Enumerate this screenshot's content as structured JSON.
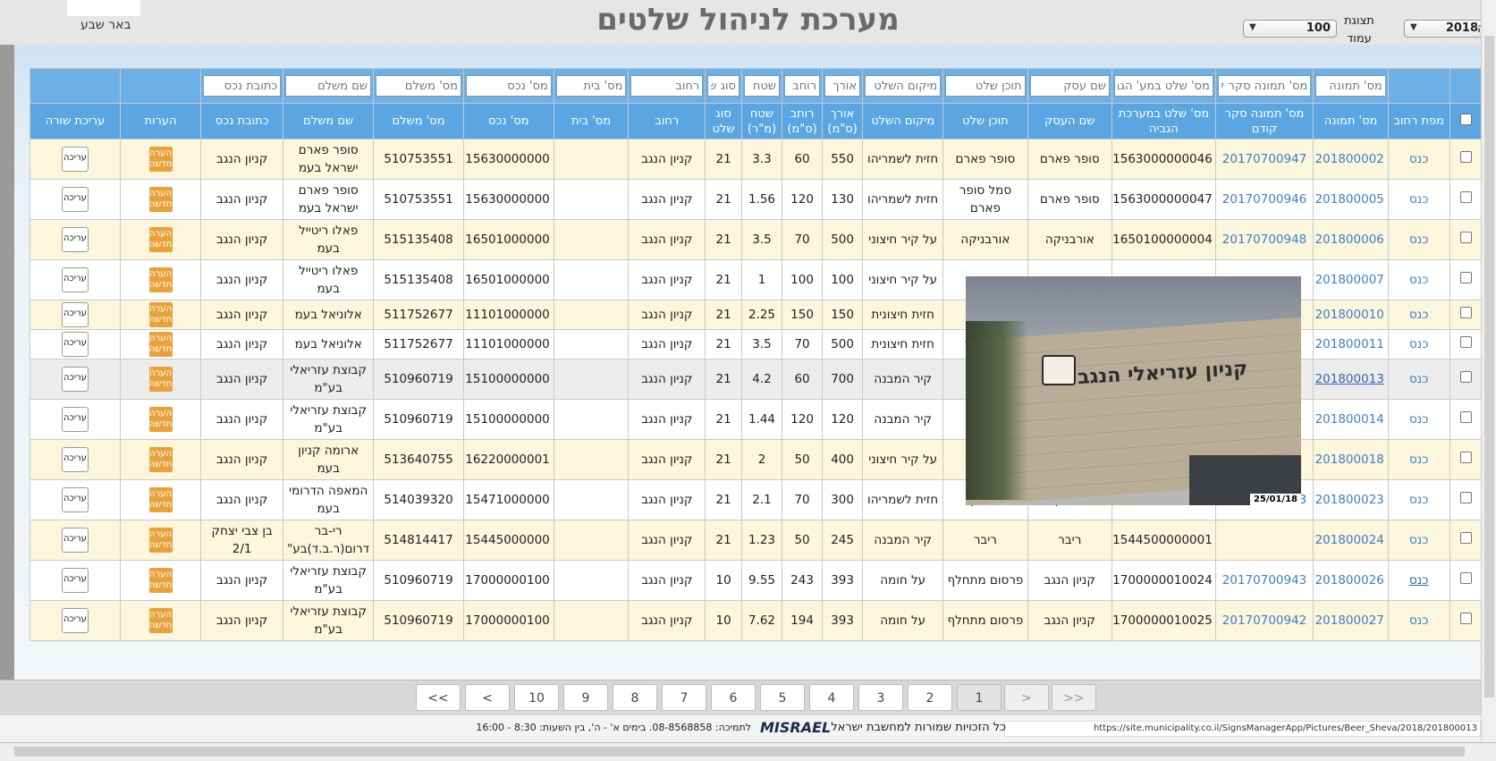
{
  "header": {
    "title": "מערכת לניהול שלטים",
    "city": "באר שבע",
    "year_label": "נה",
    "year_value": "2018",
    "page_size_label": "תצוגת עמוד",
    "page_size_value": "100"
  },
  "filters": [
    "מס' תמונה",
    "מס' תמונה סקר ק",
    "מס' שלט במע' הגב",
    "שם עסק",
    "תוכן שלט",
    "מיקום השלט",
    "אורך",
    "רוחב",
    "שטח",
    "סוג שי",
    "רחוב",
    "מס' בית",
    "מס' נכס",
    "מס' משלם",
    "שם משלם",
    "כתובת נכס"
  ],
  "columns": [
    "",
    "מפת רחוב",
    "מס' תמונה",
    "מס' תמונה סקר קודם",
    "מס' שלט במערכת הגביה",
    "שם העסק",
    "תוכן שלט",
    "מיקום השלט",
    "אורך (ס\"מ)",
    "רוחב (ס\"מ)",
    "שטח (מ\"ר)",
    "סוג שלט",
    "רחוב",
    "מס' בית",
    "מס' נכס",
    "מס' משלם",
    "שם משלם",
    "כתובת נכס",
    "הערות",
    "עריכת שורה"
  ],
  "rows": [
    {
      "map": "כנס",
      "pic": "201800002",
      "prev": "20170700947",
      "sign": "971563000000046",
      "biz": "סופר פארם",
      "content": "סופר פארם",
      "loc": "חזית לשמריהו",
      "len": "550",
      "wid": "60",
      "area": "3.3",
      "type": "21",
      "street": "קניון הנגב",
      "house": "",
      "asset": "9715630000000",
      "payer_no": "510753551",
      "payer": "סופר פארם ישראל בעמ",
      "addr": "קניון הנגב"
    },
    {
      "map": "כנס",
      "pic": "201800005",
      "prev": "20170700946",
      "sign": "971563000000047",
      "biz": "סופר פארם",
      "content": "סמל סופר פארם",
      "loc": "חזית לשמריהו",
      "len": "130",
      "wid": "120",
      "area": "1.56",
      "type": "21",
      "street": "קניון הנגב",
      "house": "",
      "asset": "9715630000000",
      "payer_no": "510753551",
      "payer": "סופר פארם ישראל בעמ",
      "addr": "קניון הנגב"
    },
    {
      "map": "כנס",
      "pic": "201800006",
      "prev": "20170700948",
      "sign": "971650100000004",
      "biz": "אורבניקה",
      "content": "אורבניקה",
      "loc": "על קיר חיצוני",
      "len": "500",
      "wid": "70",
      "area": "3.5",
      "type": "21",
      "street": "קניון הנגב",
      "house": "",
      "asset": "9716501000000",
      "payer_no": "515135408",
      "payer": "פאלו ריטייל בעמ",
      "addr": "קניון הנגב"
    },
    {
      "map": "כנס",
      "pic": "201800007",
      "prev": "",
      "sign": "",
      "biz": "",
      "content": "בניקה",
      "loc": "על קיר חיצוני",
      "len": "100",
      "wid": "100",
      "area": "1",
      "type": "21",
      "street": "קניון הנגב",
      "house": "",
      "asset": "9716501000000",
      "payer_no": "515135408",
      "payer": "פאלו ריטייל בעמ",
      "addr": "קניון הנגב"
    },
    {
      "map": "כנס",
      "pic": "201800010",
      "prev": "",
      "sign": "",
      "biz": "",
      "content": "ונלדס",
      "loc": "חזית חיצונית",
      "len": "150",
      "wid": "150",
      "area": "2.25",
      "type": "21",
      "street": "קניון הנגב",
      "house": "",
      "asset": "9711101000000",
      "payer_no": "511752677",
      "payer": "אלוניאל בעמ",
      "addr": "קניון הנגב"
    },
    {
      "map": "כנס",
      "pic": "201800011",
      "prev": "",
      "sign": "",
      "biz": "",
      "content": "ס הכשר",
      "loc": "חזית חיצונית",
      "len": "500",
      "wid": "70",
      "area": "3.5",
      "type": "21",
      "street": "קניון הנגב",
      "house": "",
      "asset": "9711101000000",
      "payer_no": "511752677",
      "payer": "אלוניאל בעמ",
      "addr": "קניון הנגב"
    },
    {
      "map": "כנס",
      "pic": "201800013",
      "prev": "",
      "sign": "",
      "biz": "",
      "content": "אלי",
      "loc": "קיר המבנה",
      "len": "700",
      "wid": "60",
      "area": "4.2",
      "type": "21",
      "street": "קניון הנגב",
      "house": "",
      "asset": "9715100000000",
      "payer_no": "510960719",
      "payer": "קבוצת עזריאלי בע\"מ",
      "addr": "קניון הנגב"
    },
    {
      "map": "כנס",
      "pic": "201800014",
      "prev": "",
      "sign": "",
      "biz": "",
      "content": "",
      "loc": "קיר המבנה",
      "len": "120",
      "wid": "120",
      "area": "1.44",
      "type": "21",
      "street": "קניון הנגב",
      "house": "",
      "asset": "9715100000000",
      "payer_no": "510960719",
      "payer": "קבוצת עזריאלי בע\"מ",
      "addr": "קניון הנגב"
    },
    {
      "map": "כנס",
      "pic": "201800018",
      "prev": "",
      "sign": "",
      "biz": "",
      "content": "ספרסו",
      "loc": "על קיר חיצוני",
      "len": "400",
      "wid": "50",
      "area": "2",
      "type": "21",
      "street": "קניון הנגב",
      "house": "",
      "asset": "9716220000001",
      "payer_no": "513640755",
      "payer": "ארומה קניון בעמ",
      "addr": "קניון הנגב"
    },
    {
      "map": "כנס",
      "pic": "201800023",
      "prev": "20170701143",
      "sign": "971547100000001",
      "biz": "רולדין",
      "content": "רולדין",
      "loc": "חזית לשמריהו",
      "len": "300",
      "wid": "70",
      "area": "2.1",
      "type": "21",
      "street": "קניון הנגב",
      "house": "",
      "asset": "9715471000000",
      "payer_no": "514039320",
      "payer": "המאפה הדרומי בעמ",
      "addr": "קניון הנגב"
    },
    {
      "map": "כנס",
      "pic": "201800024",
      "prev": "",
      "sign": "971544500000001",
      "biz": "ריבר",
      "content": "ריבר",
      "loc": "קיר המבנה",
      "len": "245",
      "wid": "50",
      "area": "1.23",
      "type": "21",
      "street": "קניון הנגב",
      "house": "",
      "asset": "9715445000000",
      "payer_no": "514814417",
      "payer": "רי-בר דרום(ר.ב.ד)בע\"",
      "addr": "בן צבי יצחק 2/1"
    },
    {
      "map": "כנס",
      "pic": "201800026",
      "prev": "20170700943",
      "sign": "971700000010024",
      "biz": "קניון הנגב",
      "content": "פרסום מתחלף",
      "loc": "על חומה",
      "len": "393",
      "wid": "243",
      "area": "9.55",
      "type": "10",
      "street": "קניון הנגב",
      "house": "",
      "asset": "9717000000100",
      "payer_no": "510960719",
      "payer": "קבוצת עזריאלי בע\"מ",
      "addr": "קניון הנגב"
    },
    {
      "map": "כנס",
      "pic": "201800027",
      "prev": "20170700942",
      "sign": "971700000010025",
      "biz": "קניון הנגב",
      "content": "פרסום מתחלף",
      "loc": "על חומה",
      "len": "393",
      "wid": "194",
      "area": "7.62",
      "type": "10",
      "street": "קניון הנגב",
      "house": "",
      "asset": "9717000000100",
      "payer_no": "510960719",
      "payer": "קבוצת עזריאלי בע\"מ",
      "addr": "קניון הנגב"
    }
  ],
  "row_buttons": {
    "note": "הערה חדשה",
    "edit": "עריכה"
  },
  "photo": {
    "sign_text": "קניון עזריאלי הנגב",
    "date": "25/01/18"
  },
  "pager": {
    "first": "<<",
    "prev": "<",
    "pages": [
      "1",
      "2",
      "3",
      "4",
      "5",
      "6",
      "7",
      "8",
      "9",
      "10"
    ],
    "next": ">",
    "last": ">>",
    "active": "1"
  },
  "footer": {
    "url": "https://site.municipality.co.il/SignsManagerApp/Pictures/Beer_Sheva/2018/201800013",
    "rights": "כל הזכויות שמורות למחשבת ישראל",
    "brand": "MISRAEL",
    "support": "לתמיכה: 08-8568858. בימים א' - ה', בין השעות: 8:30 - 16:00"
  }
}
